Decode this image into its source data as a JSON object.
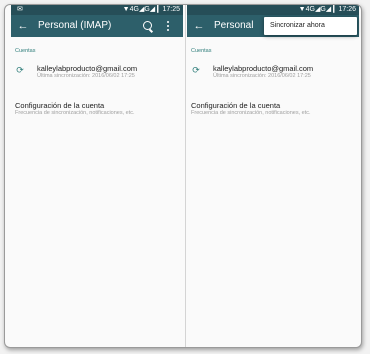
{
  "left_screen": {
    "status_bar": {
      "right": "▼4G◢G◢ ▎17:25"
    },
    "toolbar": {
      "title": "Personal (IMAP)"
    },
    "section_header": "Cuentas",
    "account": {
      "email": "kalleylabproducto@gmail.com",
      "last_sync": "Última sincronización: 2016/06/02 17:25"
    },
    "settings": {
      "title": "Configuración de la cuenta",
      "subtitle": "Frecuencia de sincronización, notificaciones, etc."
    }
  },
  "right_screen": {
    "status_bar": {
      "right": "▼4G◢G◢ ▎17:26"
    },
    "toolbar": {
      "title": "Personal"
    },
    "overflow_menu": {
      "sync_now": "Sincronizar ahora"
    },
    "section_header": "Cuentas",
    "account": {
      "email": "kalleylabproducto@gmail.com",
      "last_sync": "Última sincronización: 2016/06/02 17:25"
    },
    "settings": {
      "title": "Configuración de la cuenta",
      "subtitle": "Frecuencia de sincronización, notificaciones, etc."
    }
  },
  "icons": {
    "notification": "mail-icon",
    "back": "arrow-back-icon",
    "search": "search-icon",
    "more": "more-vert-icon",
    "sync": "sync-icon"
  },
  "colors": {
    "toolbar": "#2d5f6a",
    "status_bar": "#264e58",
    "accent": "#2e7d7a"
  }
}
